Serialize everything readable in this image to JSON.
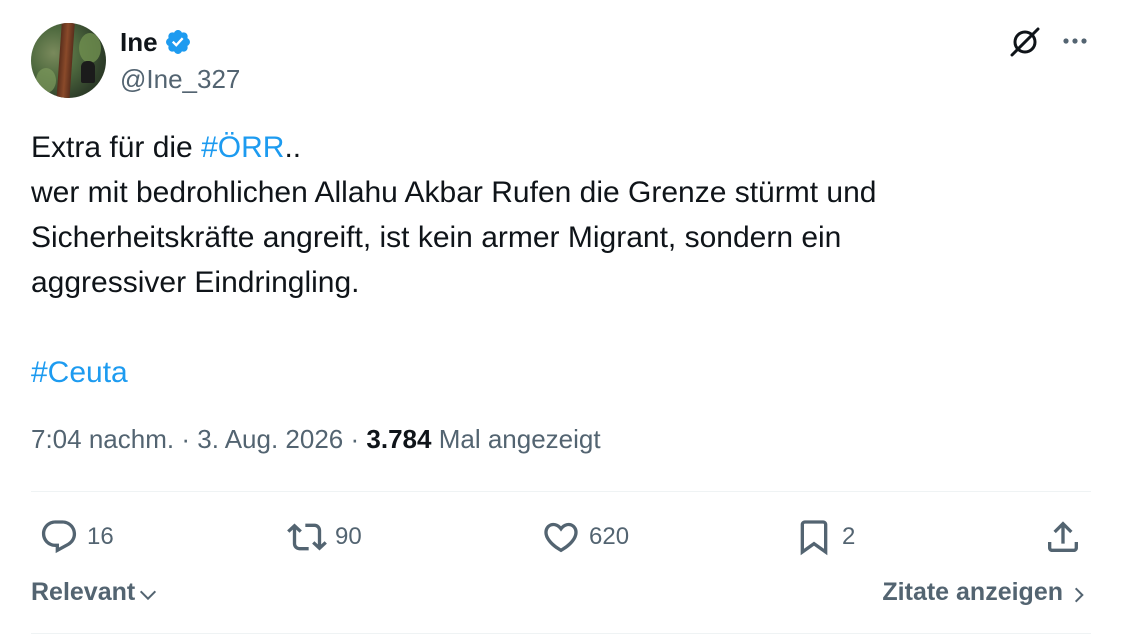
{
  "author": {
    "display_name": "Ine",
    "handle": "@Ine_327",
    "verified": true,
    "verified_color": "#1d9bf0"
  },
  "header_icons": [
    "grok-icon",
    "more-options-icon"
  ],
  "tweet": {
    "line1_prefix": "Extra für die ",
    "line1_hashtag": "#ÖRR",
    "line1_suffix": "..",
    "line2": "wer mit bedrohlichen Allahu Akbar Rufen die Grenze stürmt und",
    "line3": "Sicherheitskräfte angreift, ist kein armer Migrant, sondern ein",
    "line4": "aggressiver Eindringling.",
    "hashtag2": "#Ceuta",
    "hashtag_color": "#1d9bf0"
  },
  "meta": {
    "time": "7:04 nachm.",
    "separator": "·",
    "date": "3. Aug. 2026",
    "views_count": "3.784",
    "views_label": "Mal angezeigt"
  },
  "actions": {
    "replies": "16",
    "reposts": "90",
    "likes": "620",
    "bookmarks": "2"
  },
  "footer": {
    "sort_label": "Relevant",
    "quotes_label": "Zitate anzeigen"
  }
}
